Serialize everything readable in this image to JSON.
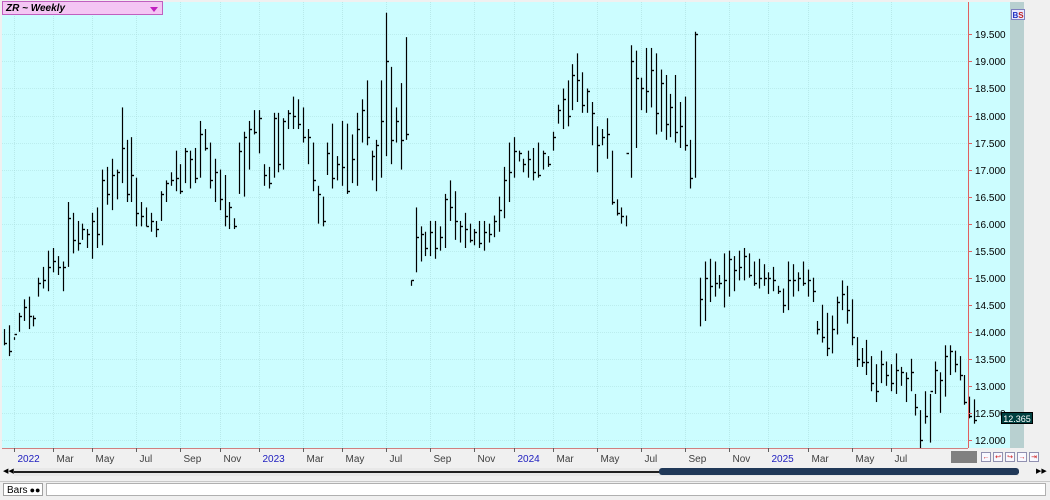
{
  "symbol_title": "ZR ~ Weekly",
  "last_price_label": "12.365",
  "bs_b": "B",
  "bs_s": "S",
  "bottom_label": "Bars",
  "colors": {
    "background": "#ccfdff",
    "grid": "#aadddd",
    "bars": "#000000",
    "price_axis": "#e06060",
    "month_label": "#404040",
    "year_label": "#2020c0"
  },
  "chart_data": {
    "type": "bar",
    "subtype": "ohlc",
    "timeframe": "weekly",
    "y_axis_ticks": [
      "12.000",
      "12.500",
      "13.000",
      "13.500",
      "14.000",
      "14.500",
      "15.000",
      "15.500",
      "16.000",
      "16.500",
      "17.000",
      "17.500",
      "18.000",
      "18.500",
      "19.000",
      "19.500"
    ],
    "ylim": [
      11.85,
      20.1
    ],
    "x_axis_labels": [
      {
        "label": "2022",
        "year": true,
        "week": 2
      },
      {
        "label": "Mar",
        "week": 10
      },
      {
        "label": "May",
        "week": 18
      },
      {
        "label": "Jul",
        "week": 27
      },
      {
        "label": "Sep",
        "week": 36
      },
      {
        "label": "Nov",
        "week": 44
      },
      {
        "label": "2023",
        "year": true,
        "week": 52
      },
      {
        "label": "Mar",
        "week": 61
      },
      {
        "label": "May",
        "week": 69
      },
      {
        "label": "Jul",
        "week": 78
      },
      {
        "label": "Sep",
        "week": 87
      },
      {
        "label": "Nov",
        "week": 96
      },
      {
        "label": "2024",
        "year": true,
        "week": 104
      },
      {
        "label": "Mar",
        "week": 112
      },
      {
        "label": "May",
        "week": 121
      },
      {
        "label": "Jul",
        "week": 130
      },
      {
        "label": "Sep",
        "week": 139
      },
      {
        "label": "Nov",
        "week": 148
      },
      {
        "label": "2025",
        "year": true,
        "week": 156
      },
      {
        "label": "Mar",
        "week": 164
      },
      {
        "label": "May",
        "week": 173
      },
      {
        "label": "Jul",
        "week": 181
      }
    ],
    "grid": true,
    "last_value": 12.365,
    "highs": [
      14.05,
      14.12,
      13.9,
      14.35,
      14.6,
      14.65,
      14.3,
      15.0,
      15.2,
      15.5,
      15.55,
      15.4,
      15.3,
      16.4,
      16.2,
      16.05,
      16.0,
      15.9,
      16.2,
      16.3,
      17.0,
      17.05,
      17.2,
      17.0,
      18.15,
      17.55,
      17.6,
      16.85,
      16.4,
      16.3,
      16.2,
      16.05,
      16.6,
      16.8,
      16.95,
      17.35,
      17.1,
      17.4,
      17.35,
      17.4,
      17.9,
      17.75,
      17.5,
      17.2,
      17.0,
      16.9,
      16.4,
      16.1,
      17.5,
      17.7,
      17.9,
      18.1,
      18.1,
      17.1,
      17.05,
      18.05,
      18.05,
      17.95,
      18.1,
      18.35,
      18.3,
      18.15,
      17.75,
      17.5,
      16.7,
      16.5,
      17.5,
      17.85,
      17.25,
      17.9,
      17.85,
      17.65,
      18.05,
      18.3,
      18.65,
      17.35,
      17.55,
      18.65,
      19.9,
      18.9,
      18.15,
      18.6,
      19.45,
      14.85,
      16.3,
      15.95,
      15.85,
      16.05,
      16.05,
      15.95,
      16.55,
      16.8,
      16.6,
      16.05,
      16.2,
      16.0,
      15.9,
      16.05,
      16.05,
      16.0,
      16.15,
      16.5,
      17.05,
      17.5,
      17.6,
      17.35,
      17.2,
      17.35,
      17.4,
      17.5,
      17.35,
      17.25,
      17.7,
      18.2,
      18.5,
      18.65,
      18.95,
      19.15,
      18.8,
      18.5,
      18.25,
      17.8,
      17.75,
      17.95,
      17.35,
      16.45,
      16.3,
      16.15,
      19.3,
      19.2,
      18.7,
      19.25,
      19.25,
      19.15,
      18.85,
      18.75,
      18.4,
      18.75,
      18.25,
      18.35,
      17.55,
      19.55,
      15.0,
      15.3,
      15.35,
      15.3,
      15.05,
      15.45,
      15.5,
      15.4,
      15.5,
      15.55,
      15.45,
      15.3,
      15.35,
      15.25,
      15.1,
      15.2,
      14.85,
      14.8,
      15.3,
      15.25,
      15.1,
      15.3,
      15.15,
      15.0,
      14.2,
      14.5,
      14.35,
      14.3,
      14.65,
      14.95,
      14.85,
      14.6,
      13.9,
      13.7,
      13.85,
      13.55,
      13.4,
      13.65,
      13.45,
      13.4,
      13.6,
      13.35,
      13.25,
      13.5,
      12.85,
      12.55,
      12.9,
      12.85,
      13.45,
      13.25,
      13.75,
      13.75,
      13.65,
      13.55,
      13.2,
      12.8,
      12.75
    ],
    "lows": [
      13.75,
      13.55,
      13.85,
      14.0,
      14.2,
      14.05,
      14.1,
      14.65,
      14.8,
      14.75,
      15.1,
      15.05,
      14.75,
      15.2,
      15.45,
      15.5,
      15.7,
      15.55,
      15.35,
      15.55,
      15.6,
      16.35,
      16.25,
      16.45,
      16.75,
      16.4,
      16.4,
      15.95,
      15.95,
      15.95,
      15.85,
      15.75,
      16.05,
      16.4,
      16.7,
      16.6,
      16.55,
      16.75,
      16.65,
      16.75,
      16.85,
      17.35,
      16.65,
      16.4,
      16.25,
      15.95,
      15.9,
      15.9,
      16.55,
      16.5,
      17.0,
      17.65,
      17.3,
      16.7,
      16.65,
      16.85,
      16.95,
      17.0,
      17.75,
      17.75,
      17.75,
      17.5,
      17.1,
      16.6,
      16.0,
      15.95,
      16.9,
      16.65,
      16.8,
      16.7,
      16.55,
      16.75,
      16.7,
      17.5,
      17.45,
      16.8,
      16.6,
      16.85,
      17.25,
      17.1,
      17.5,
      17.0,
      17.55,
      14.95,
      15.1,
      15.3,
      15.4,
      15.4,
      15.35,
      15.5,
      15.55,
      16.05,
      15.7,
      15.65,
      15.55,
      15.65,
      15.6,
      15.55,
      15.5,
      15.65,
      15.75,
      15.85,
      16.1,
      16.4,
      16.85,
      17.15,
      16.95,
      16.85,
      16.8,
      16.85,
      17.0,
      17.05,
      17.35,
      17.85,
      17.75,
      17.8,
      18.1,
      18.25,
      18.05,
      18.05,
      17.45,
      16.95,
      17.45,
      17.2,
      16.35,
      16.15,
      16.0,
      15.95,
      16.85,
      17.4,
      18.1,
      18.05,
      18.15,
      17.65,
      17.7,
      17.55,
      17.6,
      17.5,
      17.4,
      17.35,
      16.65,
      16.85,
      14.1,
      14.2,
      14.55,
      14.65,
      14.8,
      14.45,
      14.65,
      14.75,
      14.95,
      14.95,
      15.0,
      14.85,
      14.8,
      14.85,
      14.7,
      14.75,
      14.7,
      14.35,
      14.4,
      14.65,
      14.75,
      14.85,
      14.65,
      14.55,
      13.95,
      13.8,
      13.55,
      13.6,
      13.95,
      14.4,
      14.15,
      13.75,
      13.35,
      13.35,
      13.2,
      12.9,
      12.7,
      13.05,
      13.0,
      12.9,
      12.85,
      13.0,
      12.7,
      12.9,
      12.45,
      11.85,
      12.3,
      11.95,
      12.85,
      12.5,
      12.8,
      13.2,
      13.25,
      13.1,
      12.65,
      12.4,
      12.3
    ],
    "closes": [
      13.8,
      13.65,
      13.95,
      14.3,
      14.45,
      14.3,
      14.25,
      14.9,
      14.95,
      15.2,
      15.3,
      15.2,
      15.2,
      16.1,
      15.7,
      15.65,
      15.9,
      15.8,
      16.05,
      15.8,
      16.8,
      16.55,
      16.9,
      16.95,
      17.4,
      16.55,
      16.9,
      16.2,
      16.15,
      15.95,
      16.05,
      15.9,
      16.55,
      16.75,
      16.8,
      16.85,
      16.6,
      17.35,
      17.2,
      16.85,
      17.65,
      17.4,
      16.8,
      16.95,
      16.45,
      16.15,
      16.3,
      15.95,
      17.35,
      17.6,
      17.75,
      17.7,
      17.95,
      16.9,
      16.75,
      17.95,
      17.1,
      17.9,
      18.05,
      18.0,
      17.85,
      17.6,
      17.6,
      16.8,
      16.55,
      16.05,
      17.3,
      16.85,
      17.1,
      17.05,
      16.6,
      17.2,
      17.75,
      18.1,
      17.6,
      17.25,
      17.45,
      17.9,
      19.0,
      17.55,
      17.9,
      17.55,
      17.65,
      14.95,
      15.75,
      15.8,
      15.55,
      15.85,
      15.55,
      15.75,
      16.45,
      16.3,
      16.05,
      15.95,
      15.9,
      15.7,
      15.85,
      15.65,
      15.85,
      15.8,
      16.05,
      16.25,
      16.8,
      16.95,
      17.35,
      17.3,
      17.1,
      17.2,
      16.95,
      16.9,
      17.3,
      17.1,
      17.6,
      18.1,
      18.3,
      18.0,
      18.75,
      18.65,
      18.2,
      18.45,
      18.05,
      17.45,
      17.6,
      17.65,
      16.4,
      16.2,
      16.15,
      17.3,
      19.0,
      18.7,
      18.5,
      18.45,
      18.85,
      18.05,
      18.6,
      17.85,
      18.15,
      17.7,
      17.8,
      17.45,
      16.85,
      19.5,
      14.6,
      15.0,
      14.85,
      14.9,
      14.9,
      14.95,
      15.35,
      15.15,
      15.2,
      15.4,
      15.05,
      14.9,
      15.0,
      15.0,
      15.0,
      14.95,
      14.75,
      14.5,
      14.95,
      14.95,
      15.0,
      14.9,
      14.95,
      14.75,
      14.05,
      13.9,
      13.7,
      14.05,
      14.55,
      14.7,
      14.4,
      13.9,
      13.5,
      13.45,
      13.45,
      13.05,
      12.9,
      13.4,
      13.2,
      13.05,
      13.3,
      13.25,
      13.15,
      13.25,
      12.6,
      12.0,
      12.45,
      12.9,
      13.3,
      13.1,
      13.55,
      13.65,
      13.4,
      13.2,
      12.7,
      12.45,
      12.365
    ]
  }
}
